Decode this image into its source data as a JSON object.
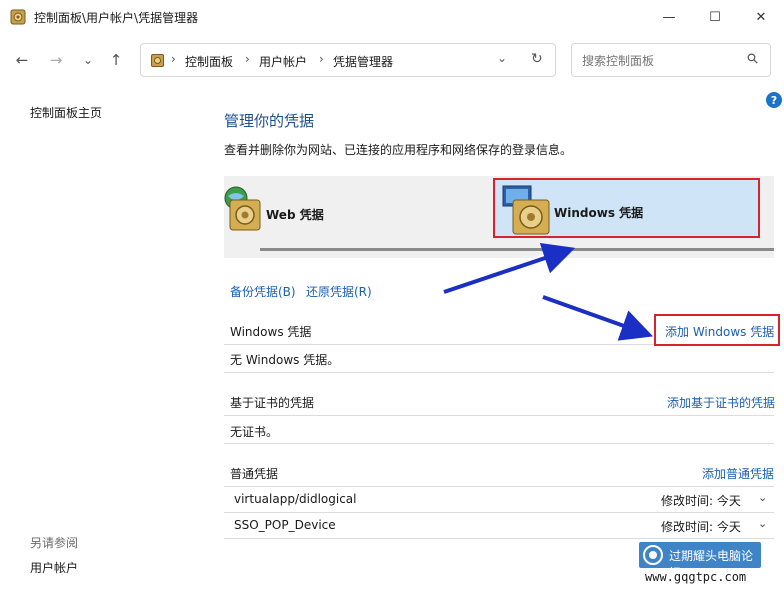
{
  "window": {
    "title": "控制面板\\用户帐户\\凭据管理器",
    "controls": {
      "minimize": "—",
      "maximize": "☐",
      "close": "✕"
    }
  },
  "address_bar": {
    "crumbs": [
      "控制面板",
      "用户帐户",
      "凭据管理器"
    ],
    "separator": "›",
    "dropdown": "⌄",
    "refresh": "↻"
  },
  "nav": {
    "back": "←",
    "forward": "→",
    "recent": "⌄",
    "up": "↑"
  },
  "search": {
    "placeholder": "搜索控制面板",
    "icon_glyph": "⚲"
  },
  "help_glyph": "?",
  "sidebar": {
    "home_link": "控制面板主页",
    "see_also_label": "另请参阅",
    "see_also_link": "用户帐户"
  },
  "main": {
    "heading": "管理你的凭据",
    "description": "查看并删除你为网站、已连接的应用程序和网络保存的登录信息。",
    "tiles": {
      "web": "Web 凭据",
      "windows": "Windows 凭据"
    },
    "actions": {
      "backup": "备份凭据(B)",
      "restore": "还原凭据(R)"
    },
    "sections": [
      {
        "title": "Windows 凭据",
        "add_link": "添加 Windows 凭据",
        "empty": "无 Windows 凭据。"
      },
      {
        "title": "基于证书的凭据",
        "add_link": "添加基于证书的凭据",
        "empty": "无证书。"
      },
      {
        "title": "普通凭据",
        "add_link": "添加普通凭据"
      }
    ],
    "generic_credentials": [
      {
        "name": "virtualapp/didlogical",
        "modified": "修改时间: 今天"
      },
      {
        "name": "SSO_POP_Device",
        "modified": "修改时间: 今天"
      }
    ],
    "row_chevron": "⌄"
  },
  "watermark": {
    "text": "过期耀头电脑论坛",
    "url": "www.gqgtpc.com"
  },
  "colors": {
    "link": "#1a5fb4",
    "heading": "#1f4e8f",
    "highlight": "#d7232e",
    "arrow": "#1a2fc4",
    "selected_tile": "#cfe5f7"
  }
}
